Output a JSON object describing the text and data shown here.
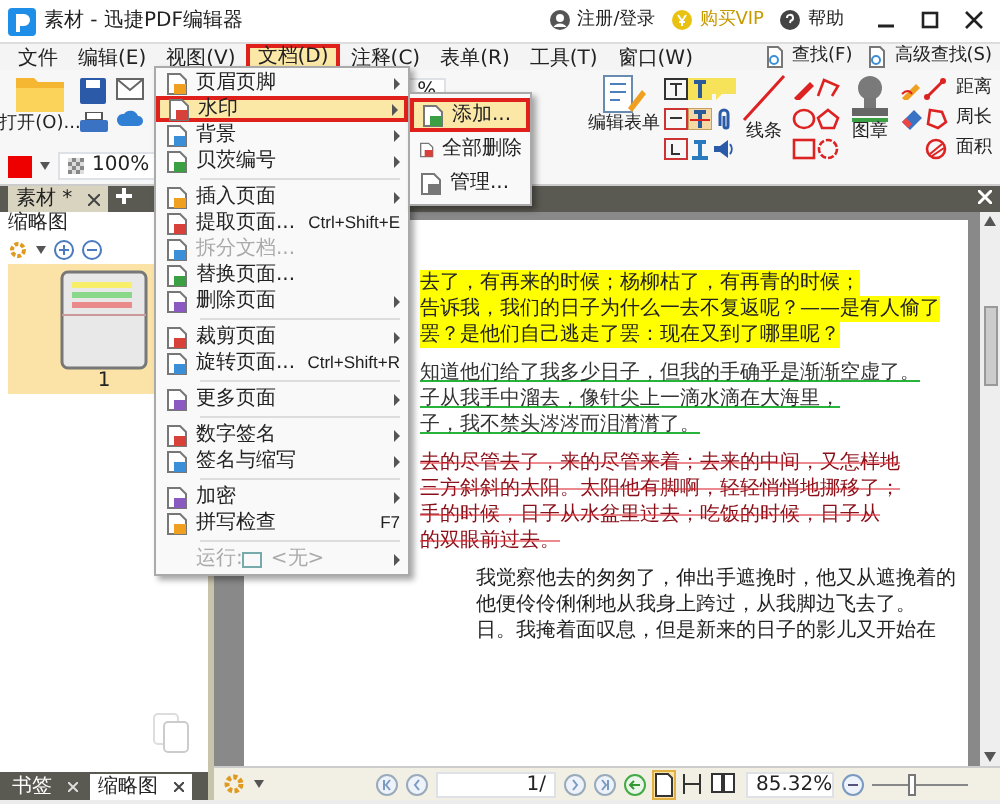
{
  "window": {
    "title": "素材 - 迅捷PDF编辑器"
  },
  "title_bar_actions": [
    {
      "kind": "user",
      "label": "注册/登录"
    },
    {
      "kind": "vip",
      "label": "购买VIP"
    },
    {
      "kind": "help",
      "label": "帮助"
    }
  ],
  "menu_bar": [
    {
      "label": "文件",
      "selected": false
    },
    {
      "label": "编辑(E)",
      "selected": false
    },
    {
      "label": "视图(V)",
      "selected": false
    },
    {
      "label": "文档(D)",
      "selected": true
    },
    {
      "label": "注释(C)",
      "selected": false
    },
    {
      "label": "表单(R)",
      "selected": false
    },
    {
      "label": "工具(T)",
      "selected": false
    },
    {
      "label": "窗口(W)",
      "selected": false
    }
  ],
  "find_buttons": [
    {
      "label": "查找(F)"
    },
    {
      "label": "高级查找(S)"
    }
  ],
  "toolbar": {
    "open_label": "打开(O)...",
    "zoom_fragment": "%",
    "opacity": "100%",
    "form_label": "编辑表单",
    "line_label": "线条",
    "stamp_label": "图章",
    "measure": [
      {
        "label": "距离"
      },
      {
        "label": "周长"
      },
      {
        "label": "面积"
      }
    ]
  },
  "document_tabs": [
    {
      "label": "素材 *",
      "selected": true
    }
  ],
  "left_panel": {
    "title": "缩略图",
    "thumbnails": [
      {
        "label": "1",
        "selected": true
      }
    ],
    "tabs": [
      {
        "label": "书签",
        "selected": false
      },
      {
        "label": "缩略图",
        "selected": true
      }
    ]
  },
  "document": {
    "paragraphs": [
      {
        "kind": "highlight",
        "lines": [
          "去了，有再来的时候；杨柳枯了，有再青的时候；",
          "告诉我，我们的日子为什么一去不复返呢？——是有人偷了",
          "罢？是他们自己逃走了罢：现在又到了哪里呢？"
        ]
      },
      {
        "kind": "underline",
        "lines": [
          "知道他们给了我多少日子，但我的手确乎是渐渐空虚了。",
          "子从我手中溜去，像针尖上一滴水滴在大海里，",
          "子，我不禁头涔涔而泪潸潸了。"
        ]
      },
      {
        "kind": "strikethrough",
        "lines": [
          "去的尽管去了，来的尽管来着；去来的中间，又怎样地",
          "三方斜斜的太阳。太阳他有脚啊，轻轻悄悄地挪移了；",
          "手的时候，日子从水盆里过去；吃饭的时候，日子从",
          "的双眼前过去。"
        ]
      },
      {
        "kind": "plain",
        "lines": [
          "我觉察他去的匆匆了，伸出手遮挽时，他又从遮挽着的",
          "他便伶伶俐俐地从我身上跨过，从我脚边飞去了。",
          "日。我掩着面叹息，但是新来的日子的影儿又开始在"
        ]
      }
    ]
  },
  "status_bar": {
    "page": "1/",
    "zoom": "85.32%",
    "zoom_slider": {
      "level": 0.4
    }
  },
  "document_menu": {
    "items": [
      {
        "kind": "item",
        "label": "页眉页脚",
        "submenu": true,
        "selected": false,
        "disabled": false
      },
      {
        "kind": "item",
        "label": "水印",
        "submenu": true,
        "selected": true,
        "disabled": false
      },
      {
        "kind": "item",
        "label": "背景",
        "submenu": true,
        "selected": false,
        "disabled": false
      },
      {
        "kind": "item",
        "label": "贝茨编号",
        "submenu": true,
        "selected": false,
        "disabled": false
      },
      {
        "kind": "separator"
      },
      {
        "kind": "item",
        "label": "插入页面",
        "submenu": true,
        "selected": false,
        "disabled": false
      },
      {
        "kind": "item",
        "label": "提取页面...",
        "shortcut": "Ctrl+Shift+E",
        "submenu": false,
        "selected": false,
        "disabled": false
      },
      {
        "kind": "item",
        "label": "拆分文档...",
        "submenu": false,
        "selected": false,
        "disabled": true
      },
      {
        "kind": "item",
        "label": "替换页面...",
        "submenu": false,
        "selected": false,
        "disabled": false
      },
      {
        "kind": "item",
        "label": "删除页面",
        "submenu": true,
        "selected": false,
        "disabled": false
      },
      {
        "kind": "separator"
      },
      {
        "kind": "item",
        "label": "裁剪页面",
        "submenu": true,
        "selected": false,
        "disabled": false
      },
      {
        "kind": "item",
        "label": "旋转页面...",
        "shortcut": "Ctrl+Shift+R",
        "submenu": false,
        "selected": false,
        "disabled": false
      },
      {
        "kind": "separator"
      },
      {
        "kind": "item",
        "label": "更多页面",
        "submenu": true,
        "selected": false,
        "disabled": false
      },
      {
        "kind": "separator"
      },
      {
        "kind": "item",
        "label": "数字签名",
        "submenu": true,
        "selected": false,
        "disabled": false
      },
      {
        "kind": "item",
        "label": "签名与缩写",
        "submenu": true,
        "selected": false,
        "disabled": false
      },
      {
        "kind": "separator"
      },
      {
        "kind": "item",
        "label": "加密",
        "submenu": true,
        "selected": false,
        "disabled": false
      },
      {
        "kind": "item",
        "label": "拼写检查",
        "shortcut": "F7",
        "submenu": false,
        "selected": false,
        "disabled": false
      },
      {
        "kind": "separator"
      },
      {
        "kind": "run",
        "label": "运行:",
        "value": "<无>",
        "submenu": true,
        "selected": false,
        "disabled": true
      }
    ]
  },
  "watermark_submenu": {
    "items": [
      {
        "label": "添加...",
        "selected": true
      },
      {
        "label": "全部删除",
        "selected": false
      },
      {
        "label": "管理...",
        "selected": false
      }
    ]
  }
}
